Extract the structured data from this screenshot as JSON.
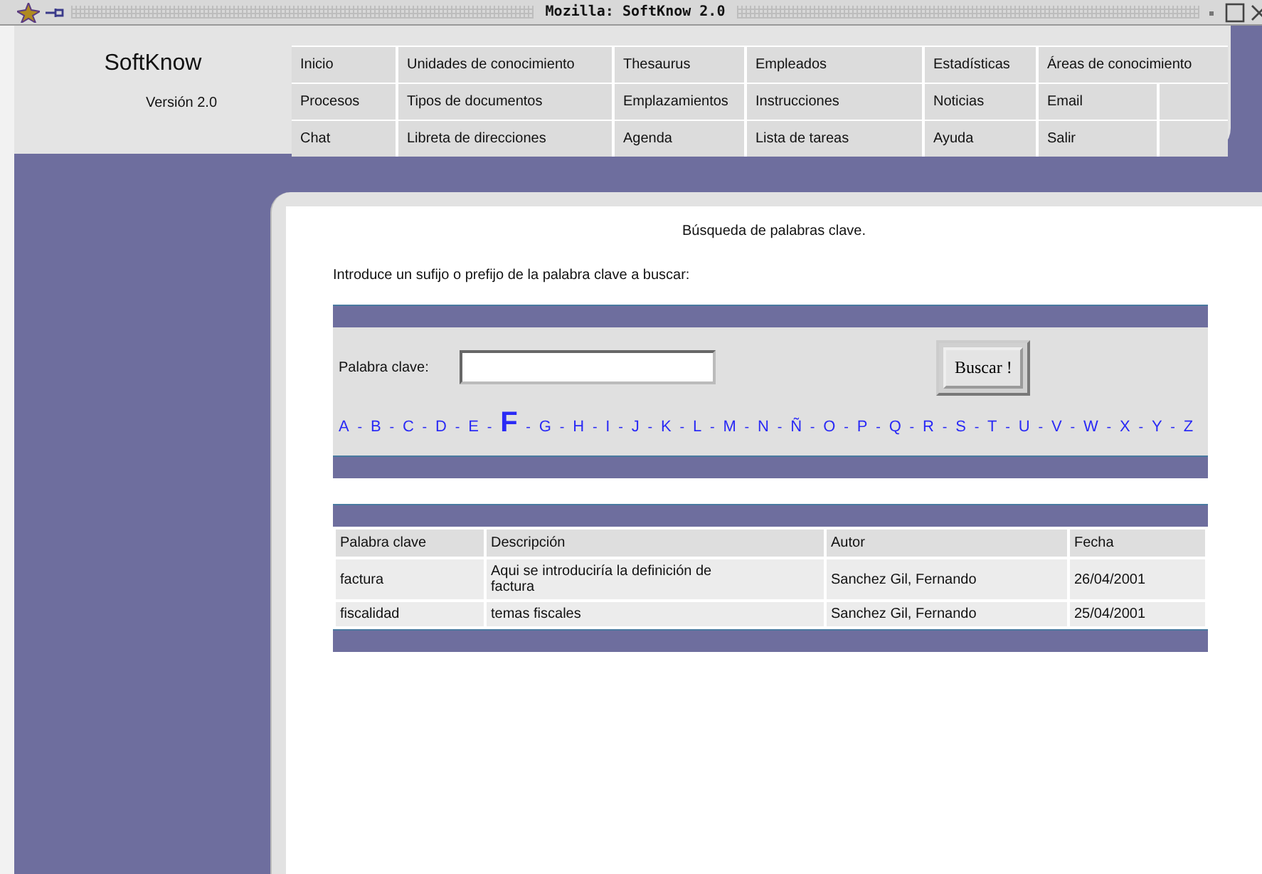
{
  "window": {
    "title": "Mozilla: SoftKnow 2.0"
  },
  "logo": {
    "name": "SoftKnow",
    "version": "Versión 2.0"
  },
  "menu": [
    [
      "Inicio",
      "Unidades de conocimiento",
      "Thesaurus",
      "Empleados",
      "Estadísticas",
      "Áreas de conocimiento"
    ],
    [
      "Procesos",
      "Tipos de documentos",
      "Emplazamientos",
      "Instrucciones",
      "Noticias",
      "Email"
    ],
    [
      "Chat",
      "Libreta de direcciones",
      "Agenda",
      "Lista de tareas",
      "Ayuda",
      "Salir"
    ]
  ],
  "heading": "Búsqueda de palabras clave.",
  "intro": "Introduce un sufijo o prefijo de la palabra clave a buscar:",
  "search": {
    "label": "Palabra clave:",
    "button": "Buscar !"
  },
  "alphabet": {
    "separator": "-",
    "letters": [
      {
        "letter": "A",
        "selected": false
      },
      {
        "letter": "B",
        "selected": false
      },
      {
        "letter": "C",
        "selected": false
      },
      {
        "letter": "D",
        "selected": false
      },
      {
        "letter": "E",
        "selected": false
      },
      {
        "letter": "F",
        "selected": true
      },
      {
        "letter": "G",
        "selected": false
      },
      {
        "letter": "H",
        "selected": false
      },
      {
        "letter": "I",
        "selected": false
      },
      {
        "letter": "J",
        "selected": false
      },
      {
        "letter": "K",
        "selected": false
      },
      {
        "letter": "L",
        "selected": false
      },
      {
        "letter": "M",
        "selected": false
      },
      {
        "letter": "N",
        "selected": false
      },
      {
        "letter": "Ñ",
        "selected": false
      },
      {
        "letter": "O",
        "selected": false
      },
      {
        "letter": "P",
        "selected": false
      },
      {
        "letter": "Q",
        "selected": false
      },
      {
        "letter": "R",
        "selected": false
      },
      {
        "letter": "S",
        "selected": false
      },
      {
        "letter": "T",
        "selected": false
      },
      {
        "letter": "U",
        "selected": false
      },
      {
        "letter": "V",
        "selected": false
      },
      {
        "letter": "W",
        "selected": false
      },
      {
        "letter": "X",
        "selected": false
      },
      {
        "letter": "Y",
        "selected": false
      },
      {
        "letter": "Z",
        "selected": false
      }
    ]
  },
  "table": {
    "columns": [
      "Palabra clave",
      "Descripción",
      "Autor",
      "Fecha"
    ],
    "rows": [
      [
        "factura",
        "Aqui se introduciría la definición de factura",
        "Sanchez Gil, Fernando",
        "26/04/2001"
      ],
      [
        "fiscalidad",
        "temas fiscales",
        "Sanchez Gil, Fernando",
        "25/04/2001"
      ]
    ]
  }
}
